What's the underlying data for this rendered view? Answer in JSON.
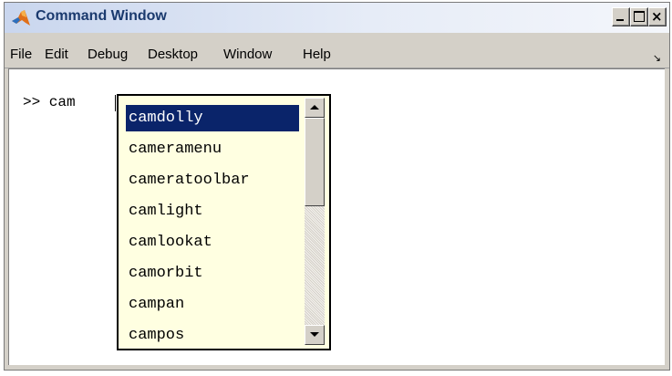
{
  "window": {
    "title": "Command Window",
    "icon": "matlab-logo-icon",
    "controls": {
      "minimize": "minimize-icon",
      "maximize": "maximize-icon",
      "close": "×"
    }
  },
  "menubar": {
    "items": [
      "File",
      "Edit",
      "Debug",
      "Desktop",
      "Window",
      "Help"
    ],
    "undock_icon": "↘"
  },
  "command": {
    "prompt": ">> cam"
  },
  "autocomplete": {
    "items": [
      "camdolly",
      "cameramenu",
      "cameratoolbar",
      "camlight",
      "camlookat",
      "camorbit",
      "campan",
      "campos"
    ],
    "selected_index": 0
  },
  "colors": {
    "selection": "#0a246a",
    "popup_background": "#ffffe1",
    "title_text": "#1a3a6e"
  }
}
